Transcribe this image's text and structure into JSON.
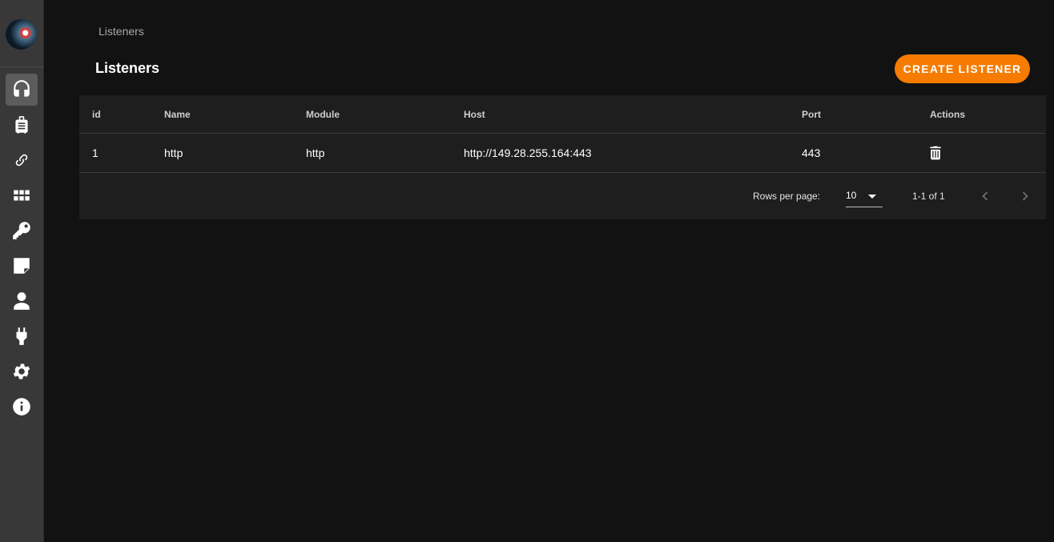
{
  "breadcrumb": "Listeners",
  "page": {
    "title": "Listeners",
    "create_button": "CREATE LISTENER"
  },
  "sidebar": {
    "items": [
      {
        "icon": "headset-icon",
        "active": true
      },
      {
        "icon": "luggage-icon"
      },
      {
        "icon": "link-icon"
      },
      {
        "icon": "apps-grid-icon"
      },
      {
        "icon": "key-icon"
      },
      {
        "icon": "sticky-note-icon"
      },
      {
        "icon": "person-icon"
      },
      {
        "icon": "plug-icon"
      },
      {
        "icon": "gear-icon"
      },
      {
        "icon": "info-icon"
      }
    ]
  },
  "table": {
    "columns": [
      "id",
      "Name",
      "Module",
      "Host",
      "Port",
      "Actions"
    ],
    "rows": [
      {
        "id": "1",
        "name": "http",
        "module": "http",
        "host": "http://149.28.255.164:443",
        "port": "443"
      }
    ]
  },
  "pagination": {
    "rows_per_page_label": "Rows per page:",
    "rows_per_page": "10",
    "range": "1-1 of 1"
  },
  "colors": {
    "accent": "#f57c00",
    "background": "#121212",
    "sidebar": "#383838",
    "card": "#1e1e1e"
  }
}
